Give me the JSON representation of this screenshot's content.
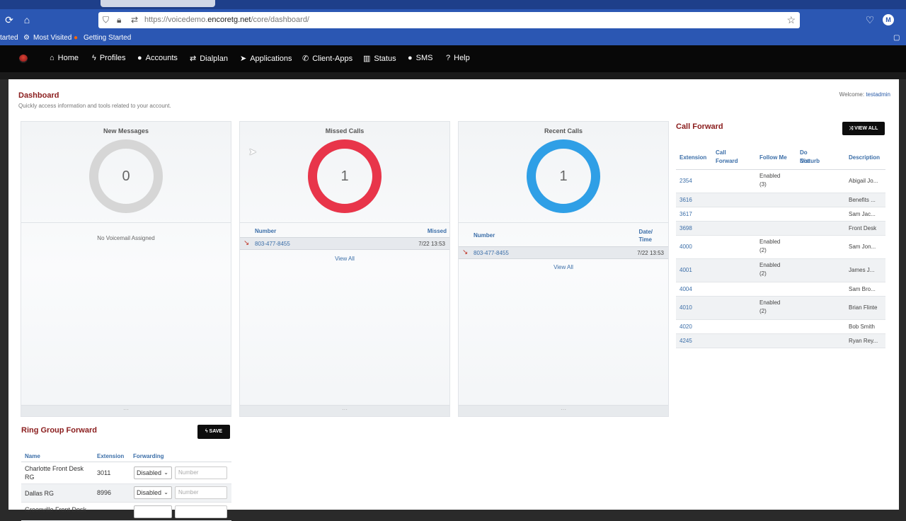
{
  "browser": {
    "url_prefix": "https://voicedemo.",
    "url_domain": "encoretg.net",
    "url_path": "/core/dashboard/",
    "bookmarks": [
      {
        "label": "tarted"
      },
      {
        "label": "Most Visited"
      },
      {
        "label": "Getting Started"
      }
    ]
  },
  "nav": {
    "items": [
      {
        "label": "Home",
        "icon": "home-icon"
      },
      {
        "label": "Profiles",
        "icon": "bolt-icon"
      },
      {
        "label": "Accounts",
        "icon": "user-icon"
      },
      {
        "label": "Dialplan",
        "icon": "swap-icon"
      },
      {
        "label": "Applications",
        "icon": "send-icon"
      },
      {
        "label": "Client-Apps",
        "icon": "phone-icon"
      },
      {
        "label": "Status",
        "icon": "bar-chart-icon"
      },
      {
        "label": "SMS",
        "icon": "comment-icon"
      },
      {
        "label": "Help",
        "icon": "question-icon"
      }
    ]
  },
  "header": {
    "title": "Dashboard",
    "subtitle": "Quickly access information and tools related to your account.",
    "welcome_label": "Welcome:",
    "username": "testadmin"
  },
  "panels": {
    "messages": {
      "title": "New Messages",
      "count": "0",
      "empty_text": "No Voicemail Assigned",
      "color": "#d6d6d6"
    },
    "missed": {
      "title": "Missed Calls",
      "count": "1",
      "color": "#e8354a",
      "col_number": "Number",
      "col_time": "Missed",
      "rows": [
        {
          "number": "803-477-8455",
          "time": "7/22 13:53"
        }
      ],
      "view_all": "View All"
    },
    "recent": {
      "title": "Recent Calls",
      "count": "1",
      "color": "#2f9fe6",
      "col_number": "Number",
      "col_time": "Date/\nTime",
      "col_time_1": "Date/",
      "col_time_2": "Time",
      "rows": [
        {
          "number": "803-477-8455",
          "time": "7/22 13:53"
        }
      ],
      "view_all": "View All"
    },
    "footer_grip": "···"
  },
  "call_forward": {
    "title": "Call Forward",
    "view_all_label": "VIEW ALL",
    "headers": {
      "extension": "Extension",
      "call_forward_1": "Call",
      "call_forward_2": "Forward",
      "follow_me": "Follow Me",
      "dnd_1": "Do Not",
      "dnd_2": "Disturb",
      "description": "Description"
    },
    "rows": [
      {
        "ext": "2354",
        "fm1": "Enabled",
        "fm2": "(3)",
        "desc": "Abigail Jo..."
      },
      {
        "ext": "3616",
        "fm1": "",
        "fm2": "",
        "desc": "Benefits ..."
      },
      {
        "ext": "3617",
        "fm1": "",
        "fm2": "",
        "desc": "Sam Jac..."
      },
      {
        "ext": "3698",
        "fm1": "",
        "fm2": "",
        "desc": "Front Desk"
      },
      {
        "ext": "4000",
        "fm1": "Enabled",
        "fm2": "(2)",
        "desc": "Sam Jon..."
      },
      {
        "ext": "4001",
        "fm1": "Enabled",
        "fm2": "(2)",
        "desc": "James J..."
      },
      {
        "ext": "4004",
        "fm1": "",
        "fm2": "",
        "desc": "Sam Bro..."
      },
      {
        "ext": "4010",
        "fm1": "Enabled",
        "fm2": "(2)",
        "desc": "Brian Flinte"
      },
      {
        "ext": "4020",
        "fm1": "",
        "fm2": "",
        "desc": "Bob Smith"
      },
      {
        "ext": "4245",
        "fm1": "",
        "fm2": "",
        "desc": "Ryan Rey..."
      }
    ]
  },
  "ring_group": {
    "title": "Ring Group Forward",
    "save_label": "SAVE",
    "headers": {
      "name": "Name",
      "extension": "Extension",
      "forwarding": "Forwarding"
    },
    "number_placeholder": "Number",
    "rows": [
      {
        "name1": "Charlotte Front Desk",
        "name2": "RG",
        "ext": "3011",
        "forwarding": "Disabled"
      },
      {
        "name1": "Dallas RG",
        "name2": "",
        "ext": "8996",
        "forwarding": "Disabled"
      },
      {
        "name1": "Greenville Front Desk",
        "name2": "",
        "ext": "",
        "forwarding": ""
      }
    ]
  }
}
